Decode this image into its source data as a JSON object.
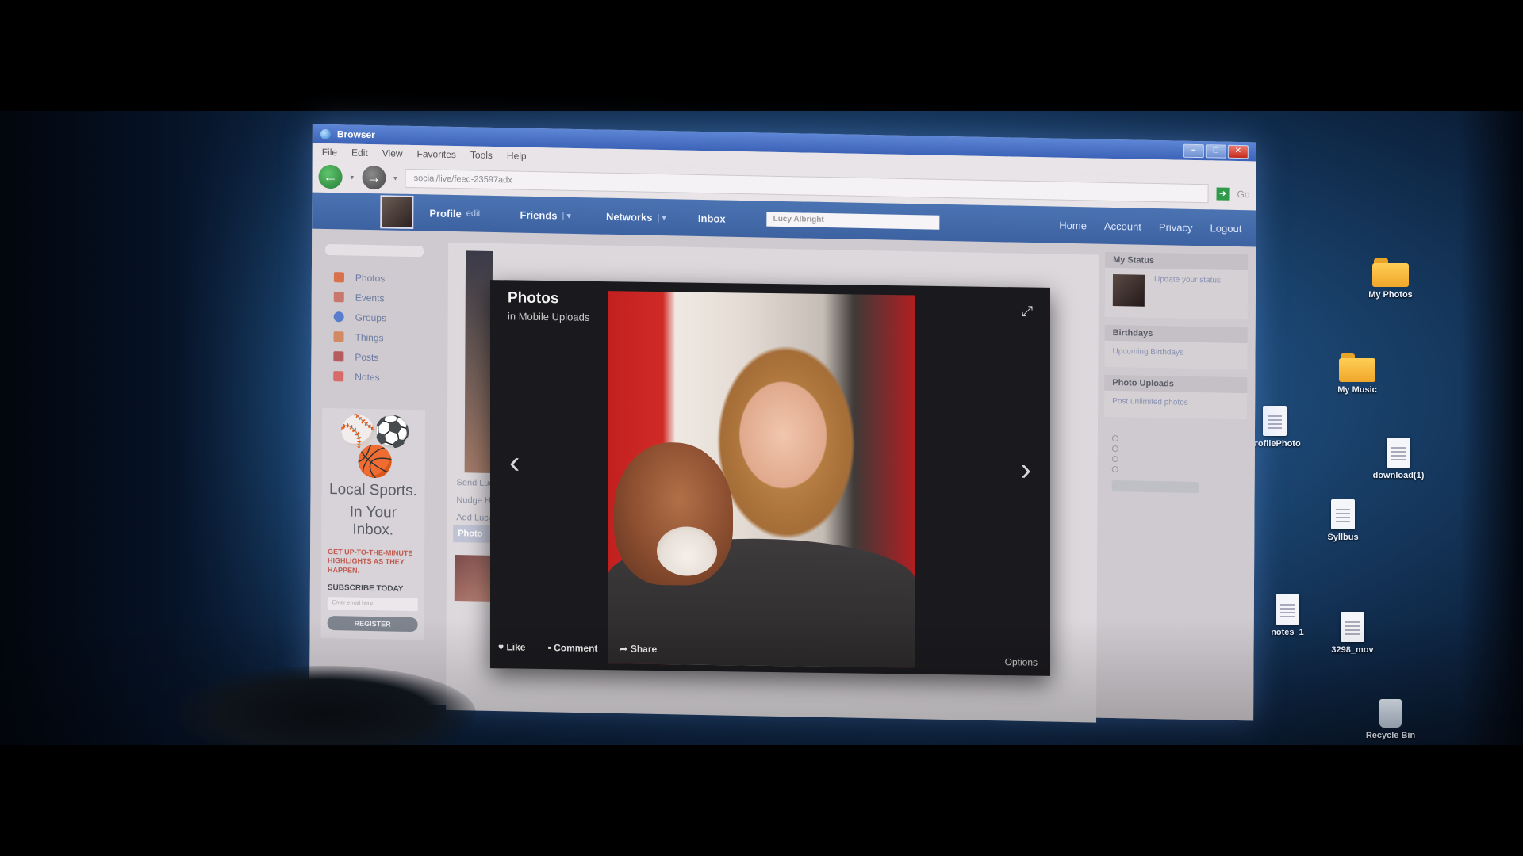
{
  "window": {
    "title": "Browser",
    "controls": {
      "minimize": "–",
      "maximize": "□",
      "close": "✕"
    }
  },
  "menu": [
    "File",
    "Edit",
    "View",
    "Favorites",
    "Tools",
    "Help"
  ],
  "address": {
    "url": "social/live/feed-23597adx",
    "go_label": "Go"
  },
  "topnav": {
    "profile_label": "Profile",
    "profile_edit": "edit",
    "friends": "Friends",
    "networks": "Networks",
    "inbox": "Inbox",
    "search_value": "Lucy Albright",
    "links": [
      "Home",
      "Account",
      "Privacy",
      "Logout"
    ]
  },
  "sidebar": {
    "items": [
      {
        "label": "Photos",
        "icon": "photos-icon",
        "color": "#d9714d"
      },
      {
        "label": "Events",
        "icon": "events-icon",
        "color": "#c9776d"
      },
      {
        "label": "Groups",
        "icon": "groups-icon",
        "color": "#5a7ccc"
      },
      {
        "label": "Things",
        "icon": "things-icon",
        "color": "#d28a62"
      },
      {
        "label": "Posts",
        "icon": "posts-icon",
        "color": "#b75c5c"
      },
      {
        "label": "Notes",
        "icon": "notes-icon",
        "color": "#d86a6a"
      }
    ]
  },
  "ad": {
    "logo": "⚾⚽🏀",
    "headline_1": "Local Sports.",
    "headline_2": "In Your Inbox.",
    "sub": "GET UP-TO-THE-MINUTE HIGHLIGHTS AS THEY HAPPEN.",
    "cta": "SUBSCRIBE TODAY",
    "email_placeholder": "Enter email here",
    "button": "REGISTER"
  },
  "profile": {
    "links": [
      "Send Lucy",
      "Nudge He",
      "Add Lucy"
    ],
    "photos_label": "Photo"
  },
  "right_rail": {
    "status_head": "My Status",
    "status_text": "Update your status",
    "birthdays_head": "Birthdays",
    "birthdays_text": "Upcoming Birthdays",
    "uploads_head": "Photo Uploads",
    "uploads_text": "Post unlimited photos"
  },
  "lightbox": {
    "title": "Photos",
    "subtitle": "in Mobile Uploads",
    "prev": "‹",
    "next": "›",
    "expand": "⤢",
    "like": "Like",
    "comment": "Comment",
    "share": "Share",
    "options": "Options"
  },
  "desktop": {
    "icons": [
      {
        "label": "My Photos",
        "type": "folder"
      },
      {
        "label": "My Music",
        "type": "folder"
      },
      {
        "label": "ProfilePhoto",
        "type": "doc"
      },
      {
        "label": "download(1)",
        "type": "doc"
      },
      {
        "label": "Syllbus",
        "type": "doc"
      },
      {
        "label": "notes_1",
        "type": "doc"
      },
      {
        "label": "3298_mov",
        "type": "doc"
      },
      {
        "label": "Recycle Bin",
        "type": "bin"
      }
    ]
  }
}
